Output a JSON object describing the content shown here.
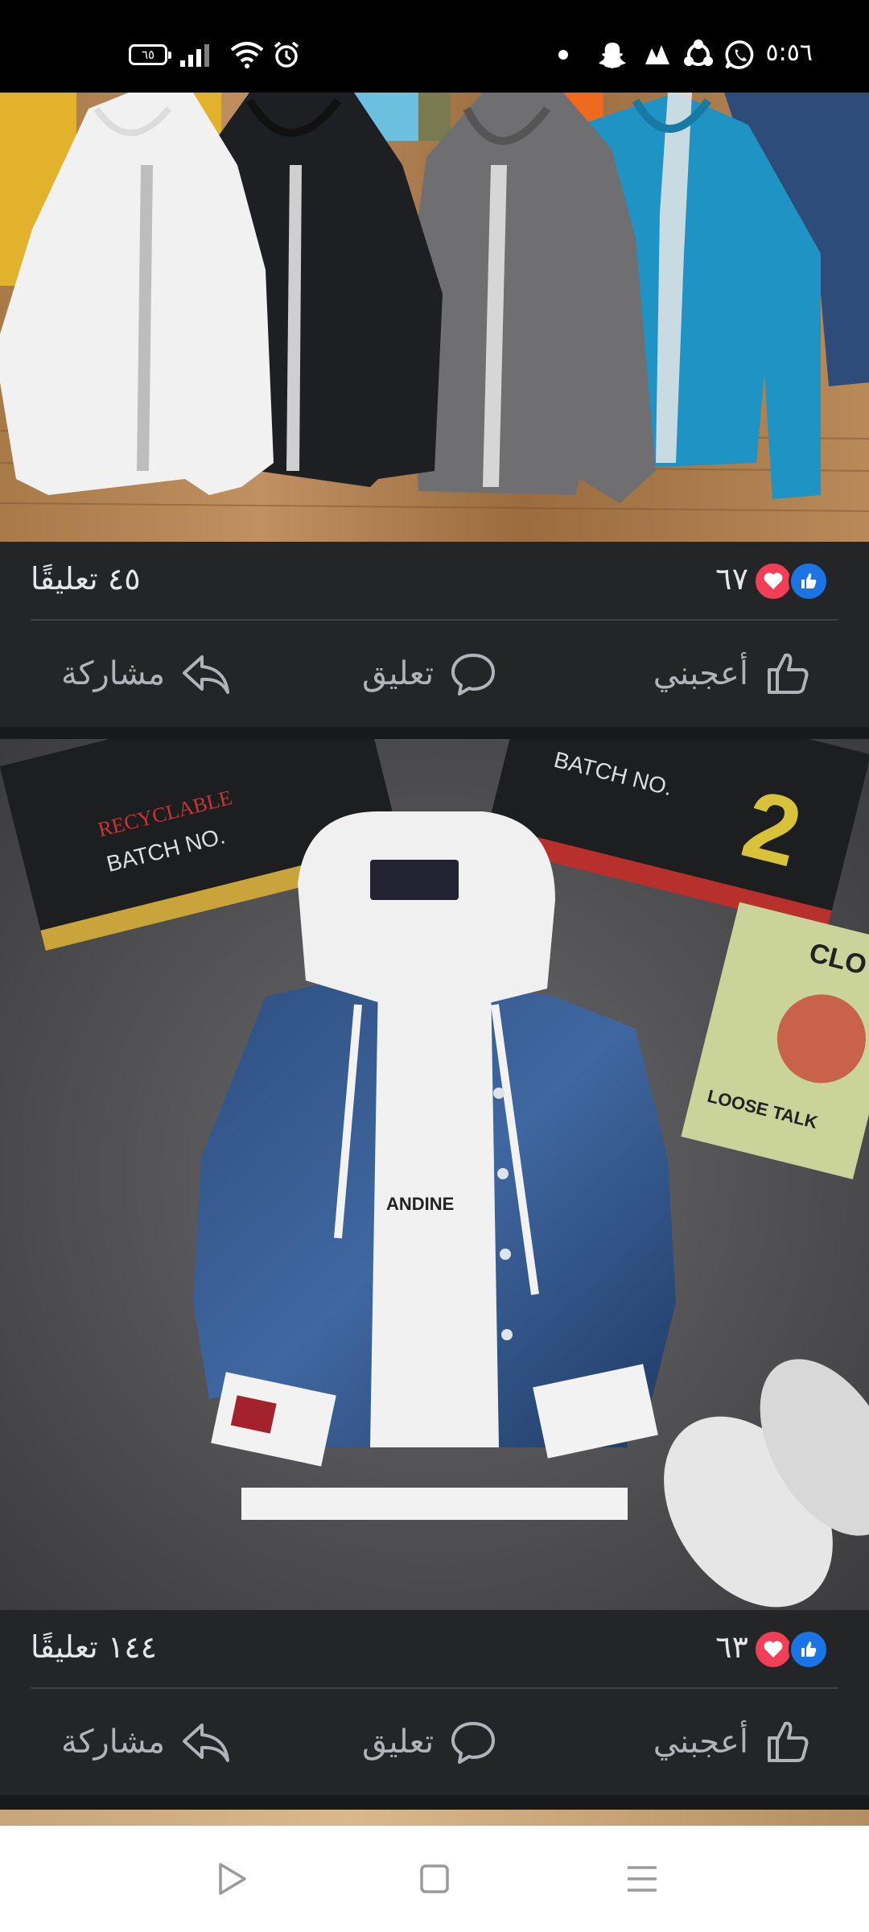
{
  "status_bar": {
    "time": "٥:٥٦",
    "battery": "٦٥",
    "icons": [
      "dot-icon",
      "snapchat-icon",
      "app-icon",
      "share-network-icon",
      "whatsapp-icon",
      "alarm-icon",
      "wifi-icon",
      "signal-icon",
      "battery-icon"
    ]
  },
  "posts": [
    {
      "image": "hoodie-jackets-photo",
      "reactions_count": "٦٧",
      "comments_label": "٤٥ تعليقًا",
      "actions": {
        "like": "أعجبني",
        "comment": "تعليق",
        "share": "مشاركة"
      }
    },
    {
      "image": "denim-jacket-photo",
      "reactions_count": "٦٣",
      "comments_label": "١٤٤ تعليقًا",
      "actions": {
        "like": "أعجبني",
        "comment": "تعليق",
        "share": "مشاركة"
      }
    }
  ],
  "navbar": {
    "buttons": [
      "back-icon",
      "home-icon",
      "menu-icon"
    ]
  },
  "colors": {
    "background": "#18191a",
    "card": "#242526",
    "like_blue": "#1b74e4",
    "love_red": "#f33e58",
    "text_muted": "#b0b3b8"
  }
}
